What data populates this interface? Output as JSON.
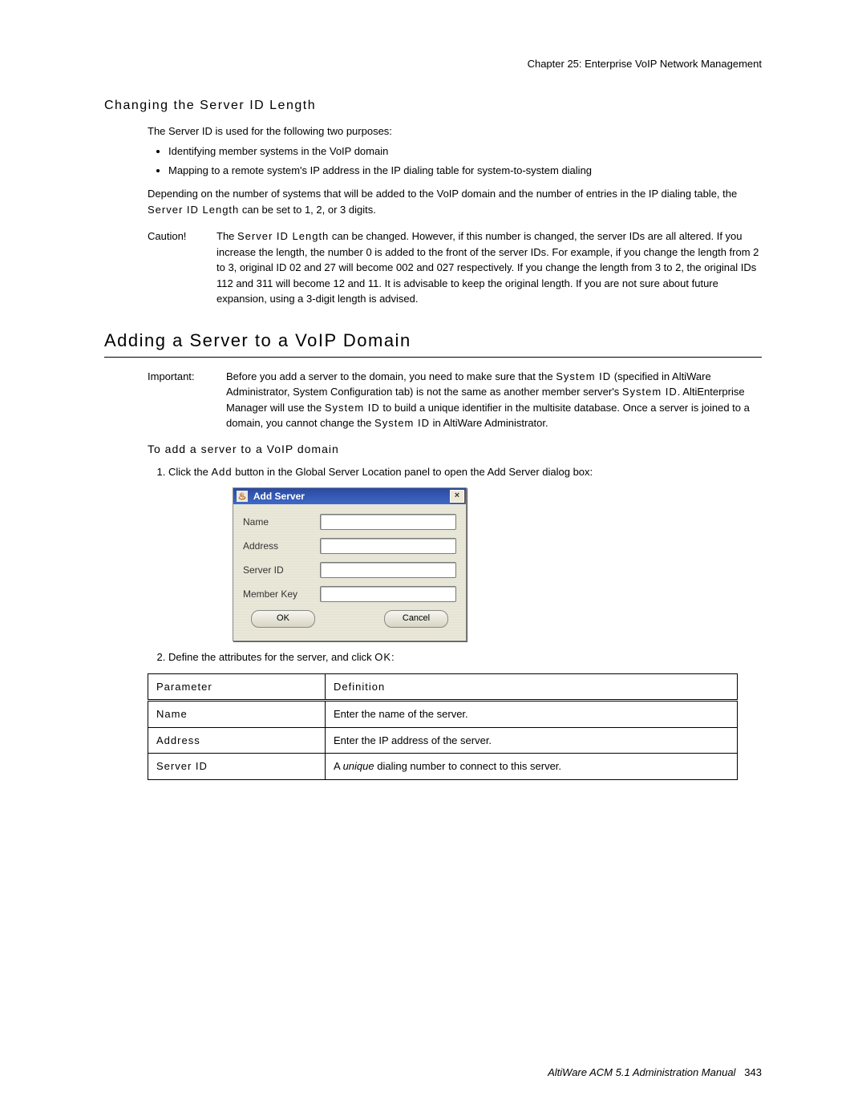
{
  "chapter_header": "Chapter 25:  Enterprise VoIP Network Management",
  "section1": {
    "heading": "Changing the Server ID Length",
    "p1": "The Server ID is used for the following two purposes:",
    "bullets": [
      "Identifying member systems in the VoIP domain",
      "Mapping to a remote system's IP address in the IP dialing table for system-to-system dialing"
    ],
    "p2_a": "Depending on the number of systems that will be added to the VoIP domain and  the number of entries in the IP dialing table, the ",
    "p2_b": "Server ID Length",
    "p2_c": " can be set to 1, 2, or 3 digits.",
    "caution_label": "Caution!",
    "caution_a": "The ",
    "caution_b": "Server ID Length",
    "caution_c": " can be changed. However, if this number is changed, the server IDs are all altered. If you increase the length, the number 0 is added to the front of the server IDs. For example, if you change the length from 2 to 3, original ID 02 and 27 will become 002 and 027 respectively. If you change the length from 3 to 2, the original IDs 112 and 311 will become 12 and 11. It is advisable to keep the original length. If you are not sure about future expansion, using a 3-digit length is advised."
  },
  "section2": {
    "heading": "Adding a Server to a VoIP Domain",
    "important_label": "Important:",
    "important_a": "Before you add a server to the domain, you need to make sure that the ",
    "important_b": "System ID",
    "important_c": " (specified in AltiWare Administrator, System Configuration tab) is not the same as another member server's ",
    "important_d": "System ID",
    "important_e": ". AltiEnterprise Manager will use the ",
    "important_f": "System ID",
    "important_g": " to build a unique identifier in the multisite database. Once a server is joined to a domain, you cannot change the ",
    "important_h": "System ID",
    "important_i": " in AltiWare Administrator.",
    "sub_heading": "To add a server to a VoIP domain",
    "step1_a": "Click the ",
    "step1_b": "Add",
    "step1_c": " button in the Global Server Location panel to open the Add Server dialog box:",
    "step2_a": "Define the attributes for the server, and click ",
    "step2_b": "OK",
    "step2_c": ":"
  },
  "dialog": {
    "title": "Add Server",
    "fields": [
      "Name",
      "Address",
      "Server ID",
      "Member Key"
    ],
    "ok": "OK",
    "cancel": "Cancel"
  },
  "table": {
    "headers": [
      "Parameter",
      "Definition"
    ],
    "rows": [
      {
        "param": "Name",
        "def_a": "Enter the name of the server.",
        "def_b": ""
      },
      {
        "param": "Address",
        "def_a": "Enter the IP address of the server.",
        "def_b": ""
      },
      {
        "param": "Server ID",
        "def_a": "A ",
        "def_i": "unique",
        "def_b": " dialing number to connect to this server."
      }
    ]
  },
  "footer_a": "AltiWare ACM 5.1 Administration Manual",
  "footer_b": "343"
}
